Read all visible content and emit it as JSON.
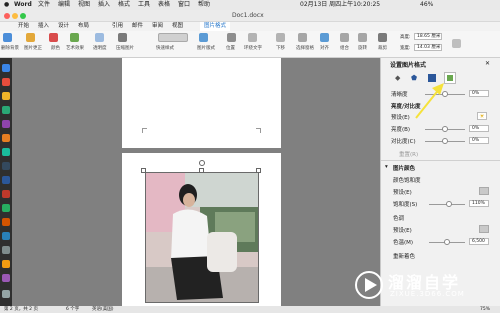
{
  "menubar": {
    "app": "Word",
    "items": [
      "文件",
      "编辑",
      "视图",
      "插入",
      "格式",
      "工具",
      "表格",
      "窗口",
      "帮助"
    ],
    "battery": "46%",
    "datetime": "02月13日 周四上午10:20:25"
  },
  "window": {
    "title": "Doc1.docx"
  },
  "ribbon": {
    "tabs": [
      "开始",
      "插入",
      "设计",
      "布局",
      "引用",
      "邮件",
      "审阅",
      "视图",
      "图片格式"
    ],
    "active_tab": "图片格式",
    "buttons": [
      "删除背景",
      "图片更正",
      "颜色",
      "艺术效果",
      "透明度",
      "压缩图片",
      "快速样式",
      "图片版式",
      "位置",
      "环绕文字",
      "下移",
      "选择窗格",
      "对齐",
      "组合",
      "旋转",
      "裁剪"
    ],
    "height_label": "高度:",
    "height_value": "18.65 厘米",
    "width_label": "宽度:",
    "width_value": "14.03 厘米"
  },
  "pane": {
    "title": "设置图片格式",
    "clarity_label": "清晰度",
    "clarity_value": "0%",
    "brightness_section": "亮度/对比度",
    "preset_label": "预设(E)",
    "brightness_label": "亮度(B)",
    "brightness_value": "0%",
    "contrast_label": "对比度(C)",
    "contrast_value": "0%",
    "reset_label": "重置(R)",
    "color_section": "图片颜色",
    "saturation_section": "颜色饱和度",
    "sat_preset_label": "预设(E)",
    "saturation_label": "饱和度(S)",
    "saturation_value": "110%",
    "tone_section": "色调",
    "tone_preset_label": "预设(E)",
    "temperature_label": "色温(M)",
    "temperature_value": "6,500",
    "recolor_label": "重新着色"
  },
  "statusbar": {
    "page": "第 2 页，共 2 页",
    "words": "6 个字",
    "lang": "英语(美国)",
    "zoom": "75%"
  },
  "watermark": {
    "brand": "溜溜自学",
    "url": "ZIXUE.3D66.COM"
  },
  "colors": {
    "accent": "#2b579a",
    "tab_active": "#1e72c9",
    "arrow": "#f5e23b"
  },
  "levels": {
    "clarity": 0.5,
    "brightness": 0.5,
    "contrast": 0.5,
    "saturation": 0.55,
    "temperature": 0.5
  }
}
